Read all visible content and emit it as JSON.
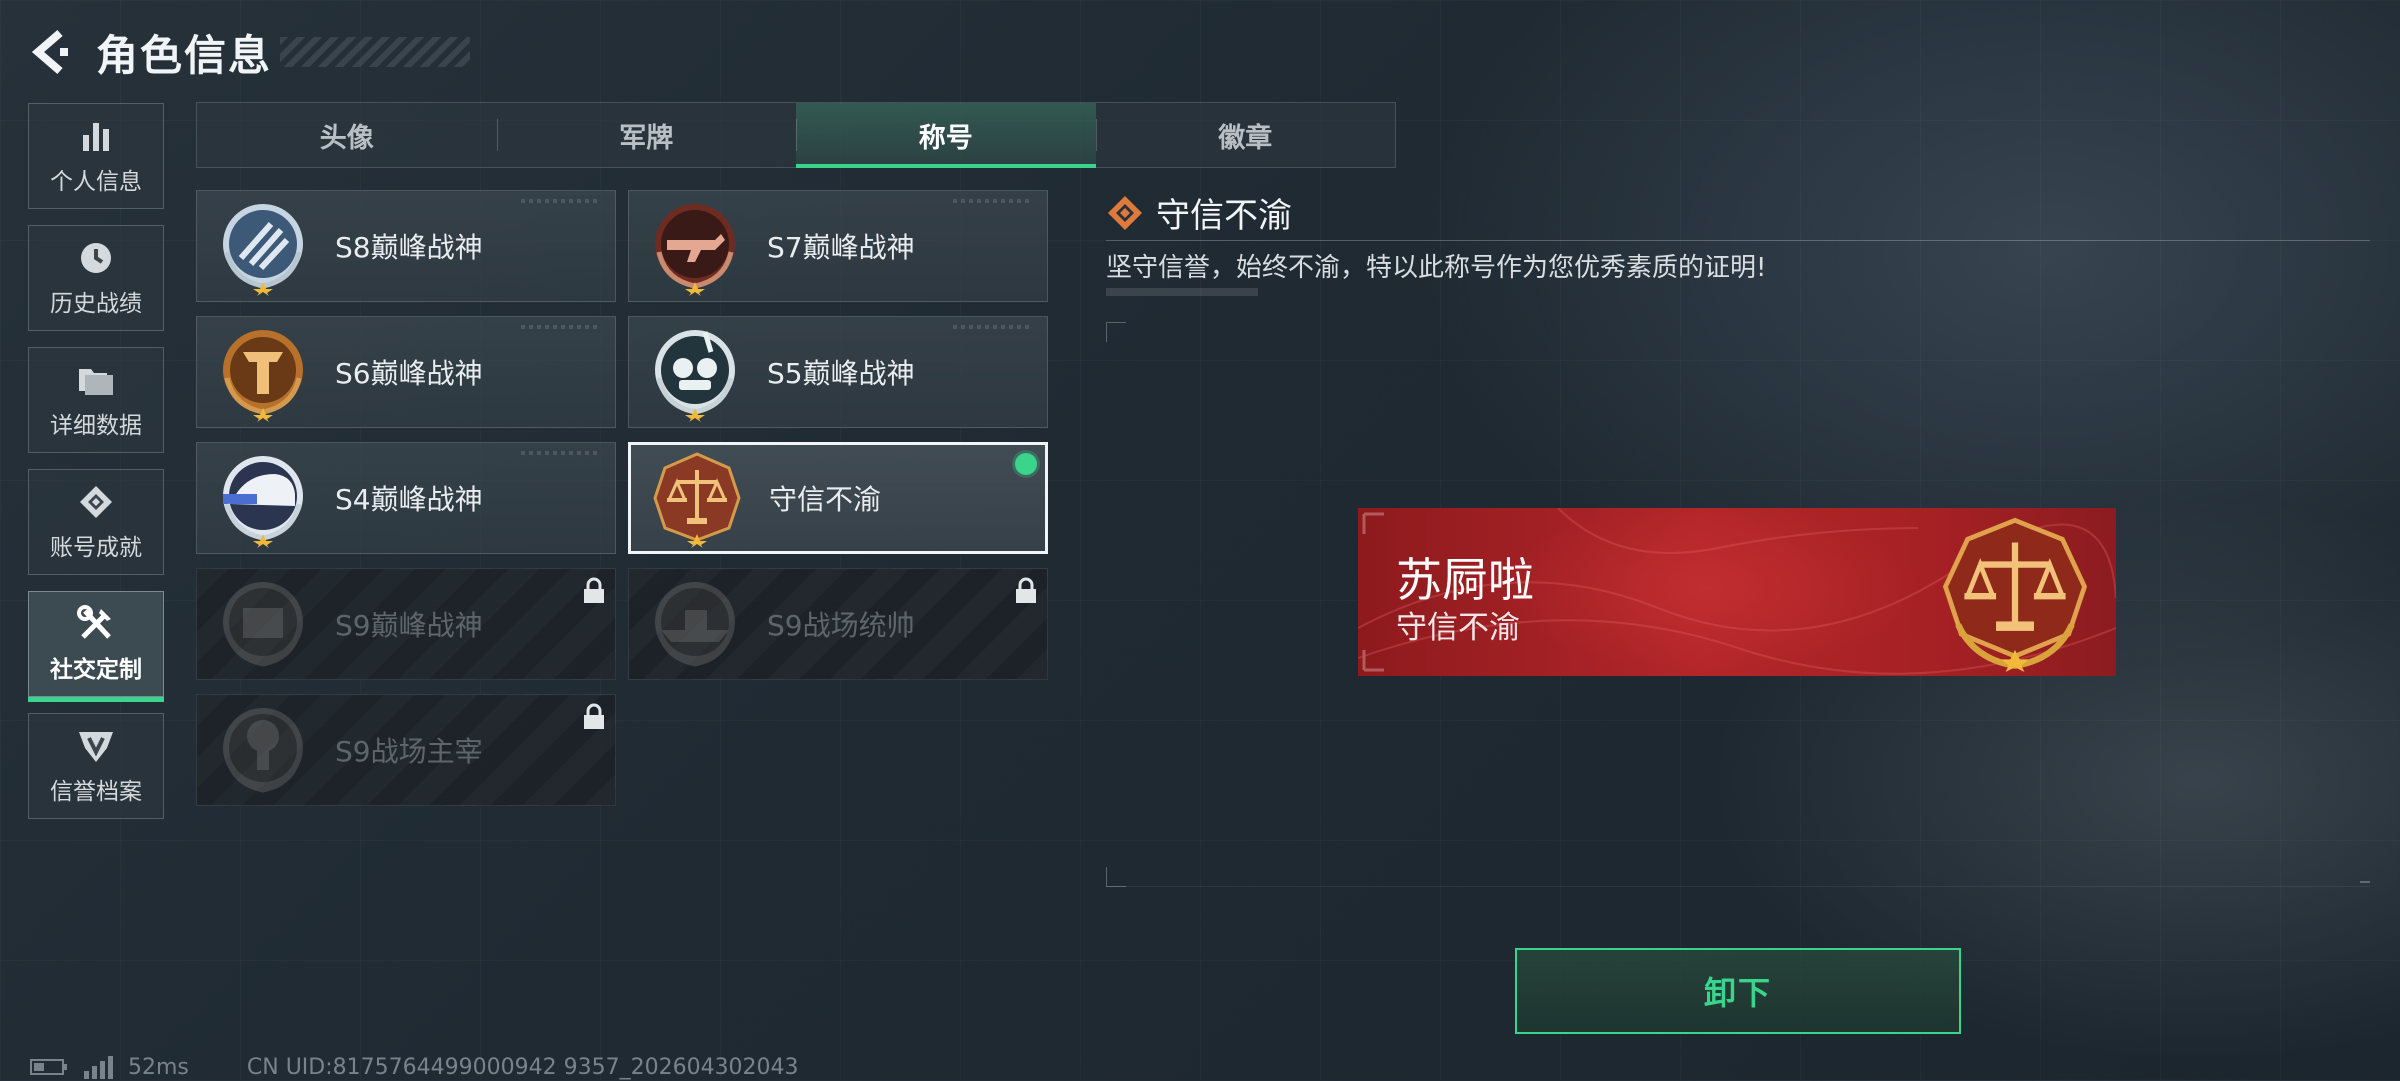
{
  "header": {
    "title": "角色信息"
  },
  "sidebar": {
    "items": [
      {
        "label": "个人信息",
        "icon": "bar-chart-icon"
      },
      {
        "label": "历史战绩",
        "icon": "clock-icon"
      },
      {
        "label": "详细数据",
        "icon": "folder-icon"
      },
      {
        "label": "账号成就",
        "icon": "achievement-icon"
      },
      {
        "label": "社交定制",
        "icon": "tools-icon",
        "active": true
      },
      {
        "label": "信誉档案",
        "icon": "shield-icon"
      }
    ]
  },
  "tabs": [
    {
      "label": "头像"
    },
    {
      "label": "军牌"
    },
    {
      "label": "称号",
      "active": true
    },
    {
      "label": "徽章"
    }
  ],
  "titles": [
    {
      "name": "S8巅峰战神",
      "state": "unlocked"
    },
    {
      "name": "S7巅峰战神",
      "state": "unlocked"
    },
    {
      "name": "S6巅峰战神",
      "state": "unlocked"
    },
    {
      "name": "S5巅峰战神",
      "state": "unlocked"
    },
    {
      "name": "S4巅峰战神",
      "state": "unlocked"
    },
    {
      "name": "守信不渝",
      "state": "equipped"
    },
    {
      "name": "S9巅峰战神",
      "state": "locked"
    },
    {
      "name": "S9战场统帅",
      "state": "locked"
    },
    {
      "name": "S9战场主宰",
      "state": "locked"
    }
  ],
  "detail": {
    "title": "守信不渝",
    "description": "坚守信誉，始终不渝，特以此称号作为您优秀素质的证明!"
  },
  "nameplate": {
    "player_name": "苏屙啦",
    "title": "守信不渝"
  },
  "actions": {
    "unequip_label": "卸下"
  },
  "footer": {
    "latency": "52ms",
    "uid": "CN UID:8175764499000942 9357_202604302043"
  },
  "colors": {
    "accent": "#3bd48d",
    "nameplate_red": "#b3262a",
    "badge_gold": "#d9a23a"
  }
}
